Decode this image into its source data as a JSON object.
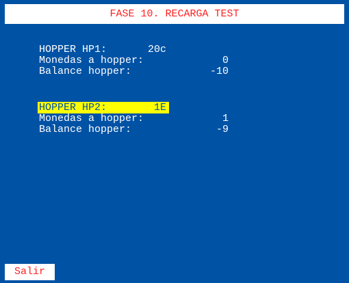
{
  "title": "FASE 10. RECARGA TEST",
  "hopper1": {
    "header_label": "HOPPER HP1:",
    "header_value": "20c",
    "coins_label": "Monedas a hopper:",
    "coins_value": "0",
    "balance_label": "Balance hopper:",
    "balance_value": "-10"
  },
  "hopper2": {
    "header_label": "HOPPER HP2:",
    "header_value": "1E",
    "coins_label": "Monedas a hopper:",
    "coins_value": "1",
    "balance_label": "Balance hopper:",
    "balance_value": "-9"
  },
  "exit_label": "Salir",
  "colors": {
    "background": "#0052a5",
    "title_text": "#ff2020",
    "highlight": "#ffff00",
    "text": "#ffffff"
  }
}
